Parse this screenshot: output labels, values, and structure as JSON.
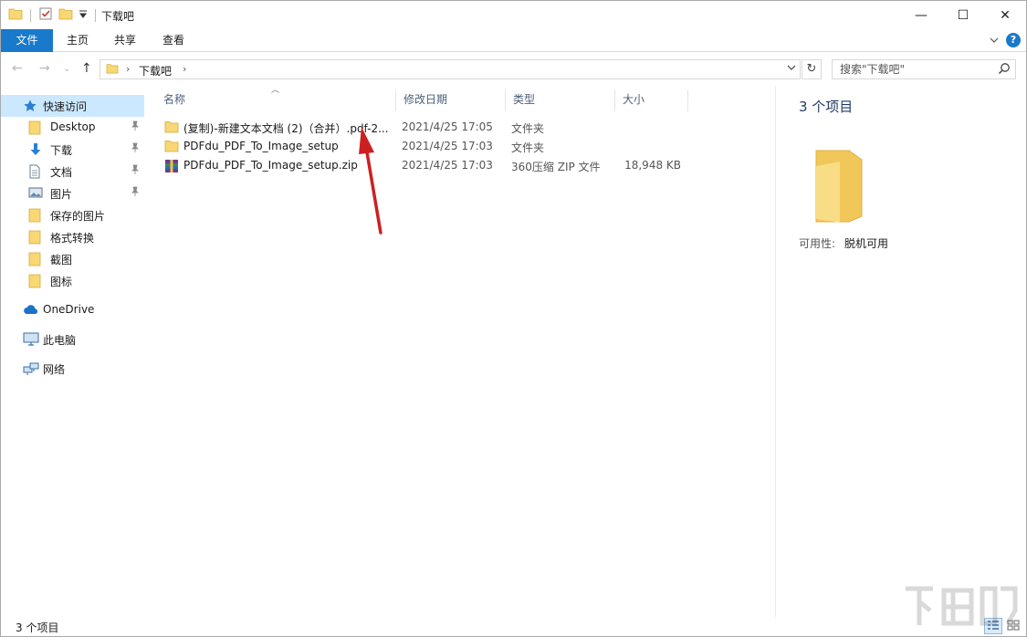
{
  "window": {
    "title": "下载吧",
    "controls": {
      "minimize": "—",
      "maximize": "☐",
      "close": "✕"
    }
  },
  "ribbon": {
    "tabs": [
      "文件",
      "主页",
      "共享",
      "查看"
    ]
  },
  "address": {
    "crumbs": [
      "下载吧"
    ],
    "search_placeholder": "搜索\"下载吧\""
  },
  "sidebar": {
    "quick_access": "快速访问",
    "items": [
      {
        "label": "Desktop",
        "icon": "folder-icon",
        "pinned": true
      },
      {
        "label": "下载",
        "icon": "download-icon",
        "pinned": true
      },
      {
        "label": "文档",
        "icon": "document-icon",
        "pinned": true
      },
      {
        "label": "图片",
        "icon": "picture-icon",
        "pinned": true
      },
      {
        "label": "保存的图片",
        "icon": "folder-icon",
        "pinned": false
      },
      {
        "label": "格式转换",
        "icon": "folder-icon",
        "pinned": false
      },
      {
        "label": "截图",
        "icon": "folder-icon",
        "pinned": false
      },
      {
        "label": "图标",
        "icon": "folder-icon",
        "pinned": false
      }
    ],
    "onedrive": "OneDrive",
    "this_pc": "此电脑",
    "network": "网络"
  },
  "columns": {
    "name": "名称",
    "date": "修改日期",
    "type": "类型",
    "size": "大小"
  },
  "files": [
    {
      "name": "(复制)-新建文本文档 (2)（合并）.pdf-2...",
      "date": "2021/4/25 17:05",
      "type": "文件夹",
      "size": "",
      "icon": "folder-icon"
    },
    {
      "name": "PDFdu_PDF_To_Image_setup",
      "date": "2021/4/25 17:03",
      "type": "文件夹",
      "size": "",
      "icon": "folder-icon"
    },
    {
      "name": "PDFdu_PDF_To_Image_setup.zip",
      "date": "2021/4/25 17:03",
      "type": "360压缩 ZIP 文件",
      "size": "18,948 KB",
      "icon": "zip-archive-icon"
    }
  ],
  "details": {
    "count": "3 个项目",
    "availability_label": "可用性:",
    "availability_value": "脱机可用"
  },
  "status": {
    "text": "3 个项目"
  },
  "colors": {
    "accent": "#1979ca",
    "selection": "#cce8ff",
    "folder": "#f8d775",
    "annotation_arrow": "#cc2020"
  }
}
